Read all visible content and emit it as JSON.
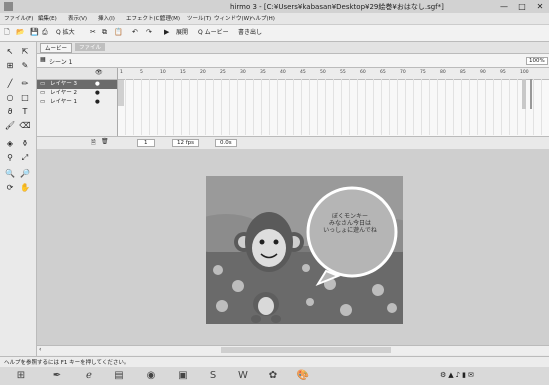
{
  "window": {
    "title": "hirmo 3 - [C:¥Users¥kabasan¥Desktop¥29絵巻¥おはなし.sgf*]",
    "buttons": [
      "—",
      "□",
      "✕"
    ]
  },
  "menu": [
    "ファイル(F)",
    "編集(E)",
    "表示(V)",
    "挿入(I)",
    "エフェクト(C)",
    "管理(M)",
    "ツール(T)",
    "ウィンドウ(W)",
    "ヘルプ(H)"
  ],
  "toolbar": {
    "zoom_button": "Q 拡大",
    "expand_button": "展開",
    "group_button": "Q ムービー",
    "export_button": "書き出し"
  },
  "tabs": {
    "movie": "ムービー",
    "file": "ファイル"
  },
  "scene": {
    "label": "シーン 1",
    "zoom": "100%"
  },
  "layers": [
    "レイヤー 3",
    "レイヤー 2",
    "レイヤー 1"
  ],
  "ruler": [
    "1",
    "5",
    "10",
    "15",
    "20",
    "25",
    "30",
    "35",
    "40",
    "45",
    "50",
    "55",
    "60",
    "65",
    "70",
    "75",
    "80",
    "85",
    "90",
    "95",
    "100"
  ],
  "timeline_footer": {
    "frame": "1",
    "fps": "12 fps",
    "time": "0.0s"
  },
  "speech_bubble": "ぼくモンキー\nみなさん今日は\nいっしょに遊んでね",
  "status": "ヘルプを参照するには F1 キーを押してください。"
}
